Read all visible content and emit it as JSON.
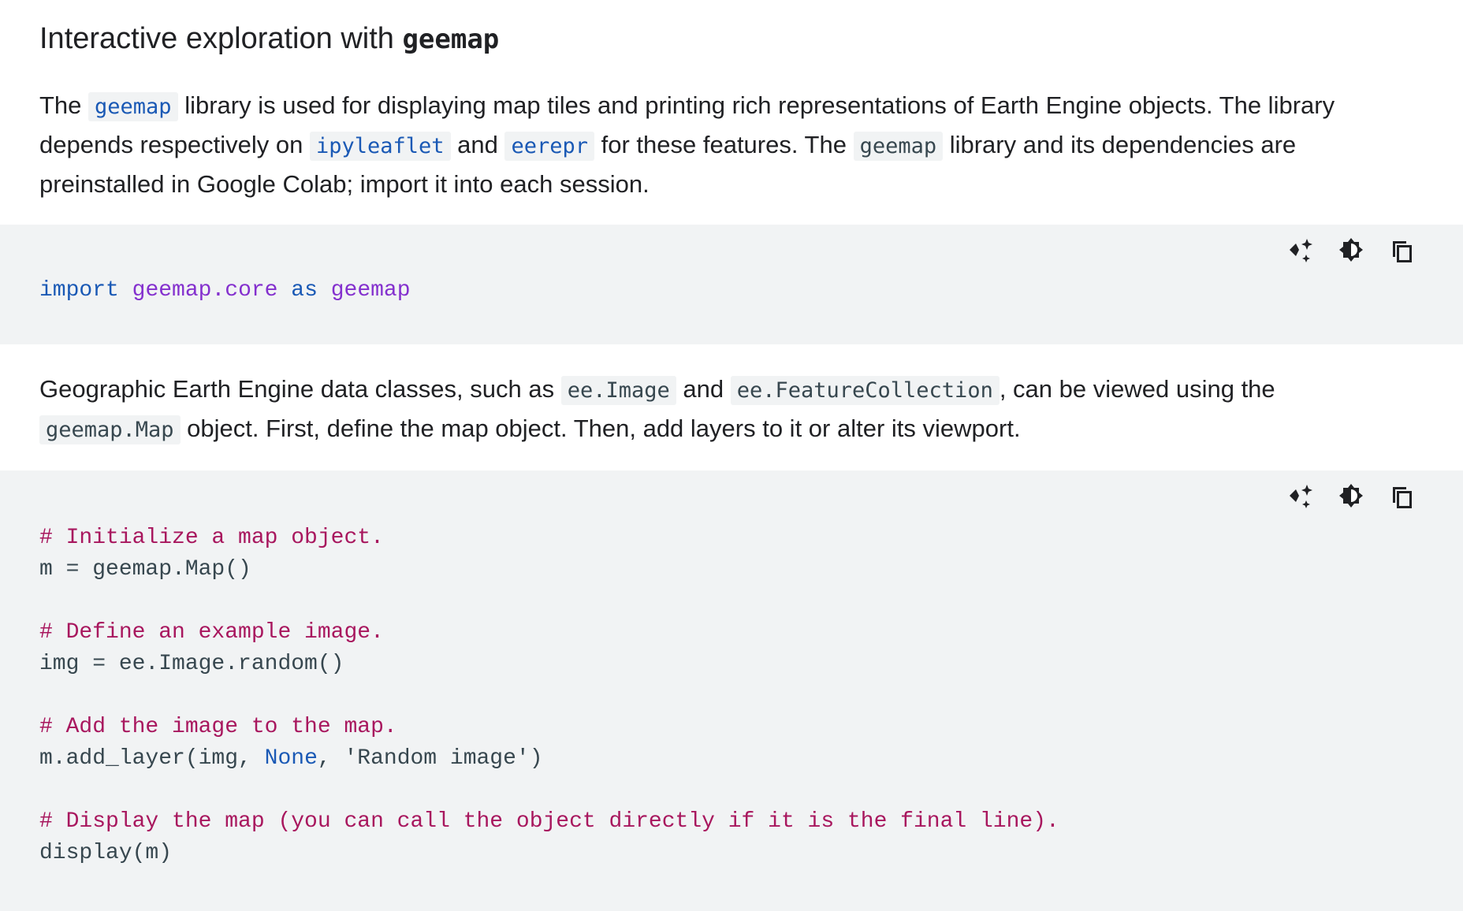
{
  "heading": {
    "text": "Interactive exploration with ",
    "code": "geemap"
  },
  "para1": {
    "t1": "The ",
    "c1": "geemap",
    "t2": " library is used for displaying map tiles and printing rich representations of Earth Engine objects. The library depends respectively on ",
    "c2": "ipyleaflet",
    "t3": " and ",
    "c3": "eerepr",
    "t4": " for these features. The ",
    "c4": "geemap",
    "t5": " library and its dependencies are preinstalled in Google Colab; import it into each session."
  },
  "code1": {
    "kw_import": "import",
    "module": "geemap.core",
    "kw_as": "as",
    "alias": "geemap"
  },
  "para2": {
    "t1": "Geographic Earth Engine data classes, such as ",
    "c1": "ee.Image",
    "t2": " and ",
    "c2": "ee.FeatureCollection",
    "t3": ", can be viewed using the ",
    "c3": "geemap.Map",
    "t4": " object. First, define the map object. Then, add layers to it or alter its viewport."
  },
  "code2": {
    "c1": "# Initialize a map object.",
    "l1": "m = geemap.Map()",
    "c2": "# Define an example image.",
    "l2": "img = ee.Image.random()",
    "c3": "# Add the image to the map.",
    "l3a": "m.add_layer(img, ",
    "l3b": "None",
    "l3c": ", 'Random image')",
    "c4": "# Display the map (you can call the object directly if it is the final line).",
    "l4": "display(m)"
  },
  "toolbar_icons": [
    "sparkle-icon",
    "theme-toggle-icon",
    "copy-icon"
  ],
  "colors": {
    "code_bg": "#f1f3f4",
    "keyword": "#1a59b5",
    "name": "#8430ce",
    "comment": "#a8175e",
    "code_text": "#37474f"
  }
}
